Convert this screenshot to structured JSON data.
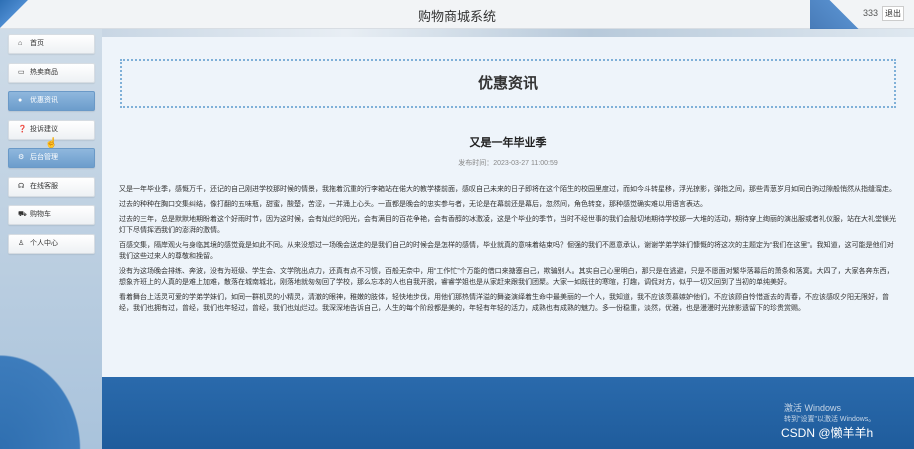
{
  "header": {
    "title": "购物商城系统",
    "username": "333",
    "logout_label": "退出"
  },
  "sidebar": {
    "items": [
      {
        "label": "首页",
        "icon": "home-icon",
        "glyph": "⌂",
        "active": false
      },
      {
        "label": "热卖商品",
        "icon": "shop-icon",
        "glyph": "▭",
        "active": false
      },
      {
        "label": "优惠资讯",
        "icon": "news-icon",
        "glyph": "●",
        "active": true
      },
      {
        "label": "投诉建议",
        "icon": "question-icon",
        "glyph": "❓",
        "active": false
      },
      {
        "label": "后台管理",
        "icon": "admin-icon",
        "glyph": "⚙",
        "active": true
      },
      {
        "label": "在线客服",
        "icon": "headset-icon",
        "glyph": "☊",
        "active": false
      },
      {
        "label": "购物车",
        "icon": "cart-icon",
        "glyph": "⛟",
        "active": false
      },
      {
        "label": "个人中心",
        "icon": "user-icon",
        "glyph": "♙",
        "active": false
      }
    ]
  },
  "main": {
    "section_title": "优惠资讯",
    "article": {
      "title": "又是一年毕业季",
      "publish_time": "发布时间：2023-03-27 11:00:59",
      "paragraphs": [
        "又是一年毕业季，感慨万千，还记的自己刚进学校那时候的情景，我拖着沉重的行李箱站在偌大的教学楼前面，感叹自己未来的日子即将在这个陌生的校园里度过，而如今斗转星移，浮光掠影，弹指之间，那些青葱岁月如同白驹过隙般悄然从指缝溜走。",
        "过去的种种在胸口交集纠结，像打翻的五味瓶，甜蜜，酸楚，苦涩，一并涌上心头。一直都是晚会的忠实参与者，无论是在幕前还是幕后，忽然间，角色转变，那种感觉确实难以用语言表达。",
        "过去的三年，总是默默地期盼着这个好雨时节，因为这时候，会有灿烂的阳光，会有满目的百花争艳，会有香醇的冰激凌，这是个毕业的季节，当时不经世事的我们会殷切地期待学校那一大堆的活动，期待穿上绚丽的演出服或者礼仪服，站在大礼堂镁光灯下尽情挥洒我们的澎湃的激情。",
        "百感交集，隔岸观火与身临其境的感觉竟是如此不同。从来没想过一场晚会送走的是我们自己的时候会是怎样的感情，毕业就真的意味着结束吗？倔强的我们不愿意承认，谢谢学弟学妹们慷慨的将这次的主题定为“我们在这里”。我知道，这可能是他们对我们这些过来人的尊敬和挽留。",
        "没有为这场晚会排练、奔波，没有为班级、学生会、文学院出点力，还真有点不习惯，百般无奈中，用“工作忙”个万能的借口来搪塞自己，欺骗别人。其实自己心里明白，那只是在逃避，只是不愿面对繁华落幕后的萧条和落寞。大四了，大家各奔东西，想象齐班上的人真的是难上加难，散落在城南城北，刚落地就匆匆回了学校，那么忘本的人也自我开脱，睿睿学姐也是从家赶来跟我们团聚。大家一如既往的寒暄，打趣，调侃对方，似乎一切又回到了当初的单纯美好。",
        "看着舞台上活灵可爱的学弟学妹们，如同一群机灵的小精灵，清澈的眼神，稚嫩的肢体，轻快地步伐，用他们那热情洋溢的舞姿演绎着生命中最美丽的一个人，我知道，我不应该羡慕嫉妒他们，不应该顾自怜惜逝去的青春，不应该感叹夕阳无限好，曾经，我们也拥有过，曾经，我们也年轻过，曾经，我们也灿烂过。我深深地告诉自己，人生的每个阶段都是美的，年轻有年轻的活力，成熟也有成熟的魅力。多一份稳重，淡然，优雅，也是漫漫时光掠影遗留下的珍贵赏赐。"
      ]
    }
  },
  "overlay": {
    "activation_line1": "激活 Windows",
    "activation_line2": "转到\"设置\"以激活 Windows。",
    "csdn_credit": "CSDN @懒羊羊h"
  }
}
